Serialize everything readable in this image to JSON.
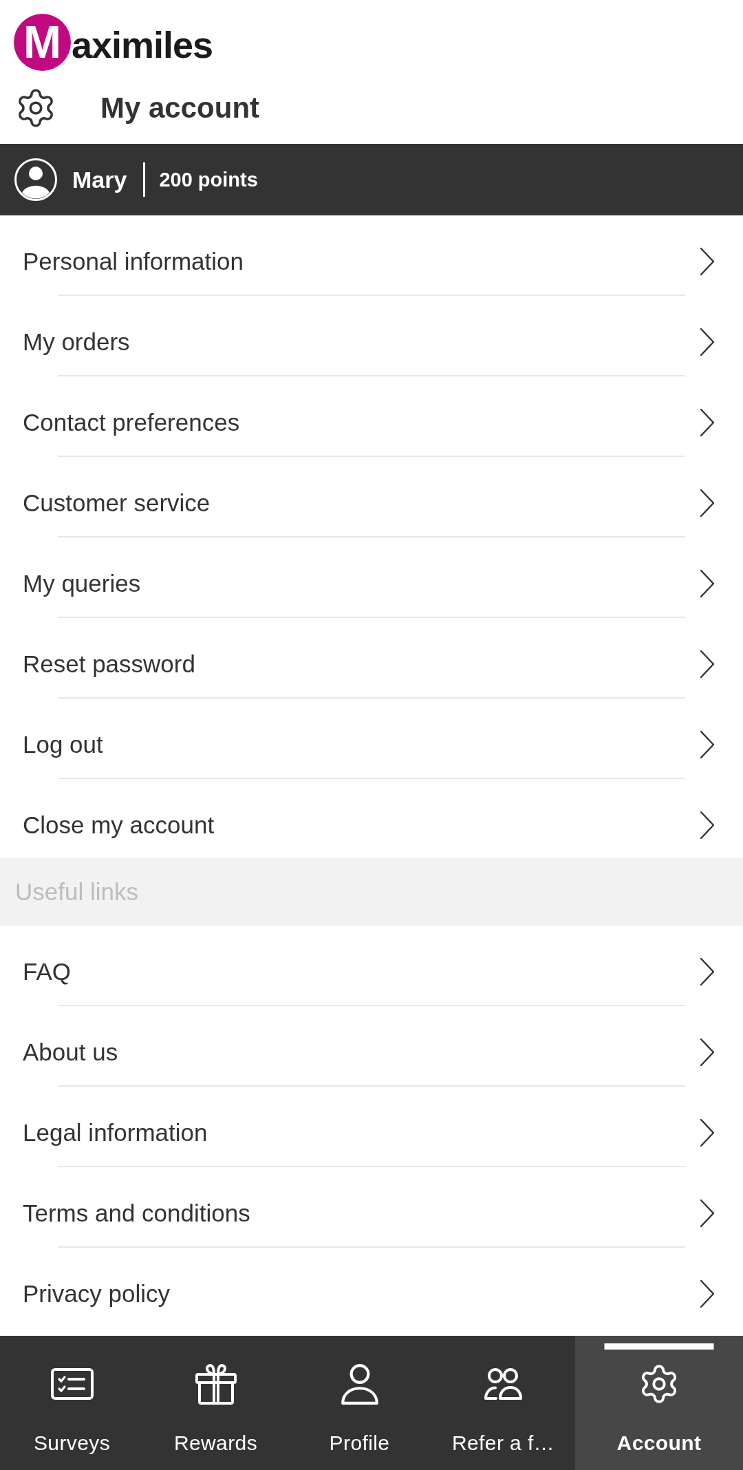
{
  "logo": {
    "initial": "M",
    "rest": "aximiles"
  },
  "header": {
    "title": "My account"
  },
  "user_bar": {
    "name": "Mary",
    "points": "200 points"
  },
  "account_menu": [
    {
      "label": "Personal information"
    },
    {
      "label": "My orders"
    },
    {
      "label": "Contact preferences"
    },
    {
      "label": "Customer service"
    },
    {
      "label": "My queries"
    },
    {
      "label": "Reset password"
    },
    {
      "label": "Log out"
    },
    {
      "label": "Close my account"
    }
  ],
  "useful_links": {
    "heading": "Useful links",
    "items": [
      {
        "label": "FAQ"
      },
      {
        "label": "About us"
      },
      {
        "label": "Legal information"
      },
      {
        "label": "Terms and conditions"
      },
      {
        "label": "Privacy policy"
      }
    ]
  },
  "bottom_nav": [
    {
      "label": "Surveys",
      "kind": "checklist",
      "selected": false
    },
    {
      "label": "Rewards",
      "kind": "gift",
      "selected": false
    },
    {
      "label": "Profile",
      "kind": "person",
      "selected": false
    },
    {
      "label": "Refer a f…",
      "kind": "people",
      "selected": false
    },
    {
      "label": "Account",
      "kind": "gear",
      "selected": true
    }
  ]
}
